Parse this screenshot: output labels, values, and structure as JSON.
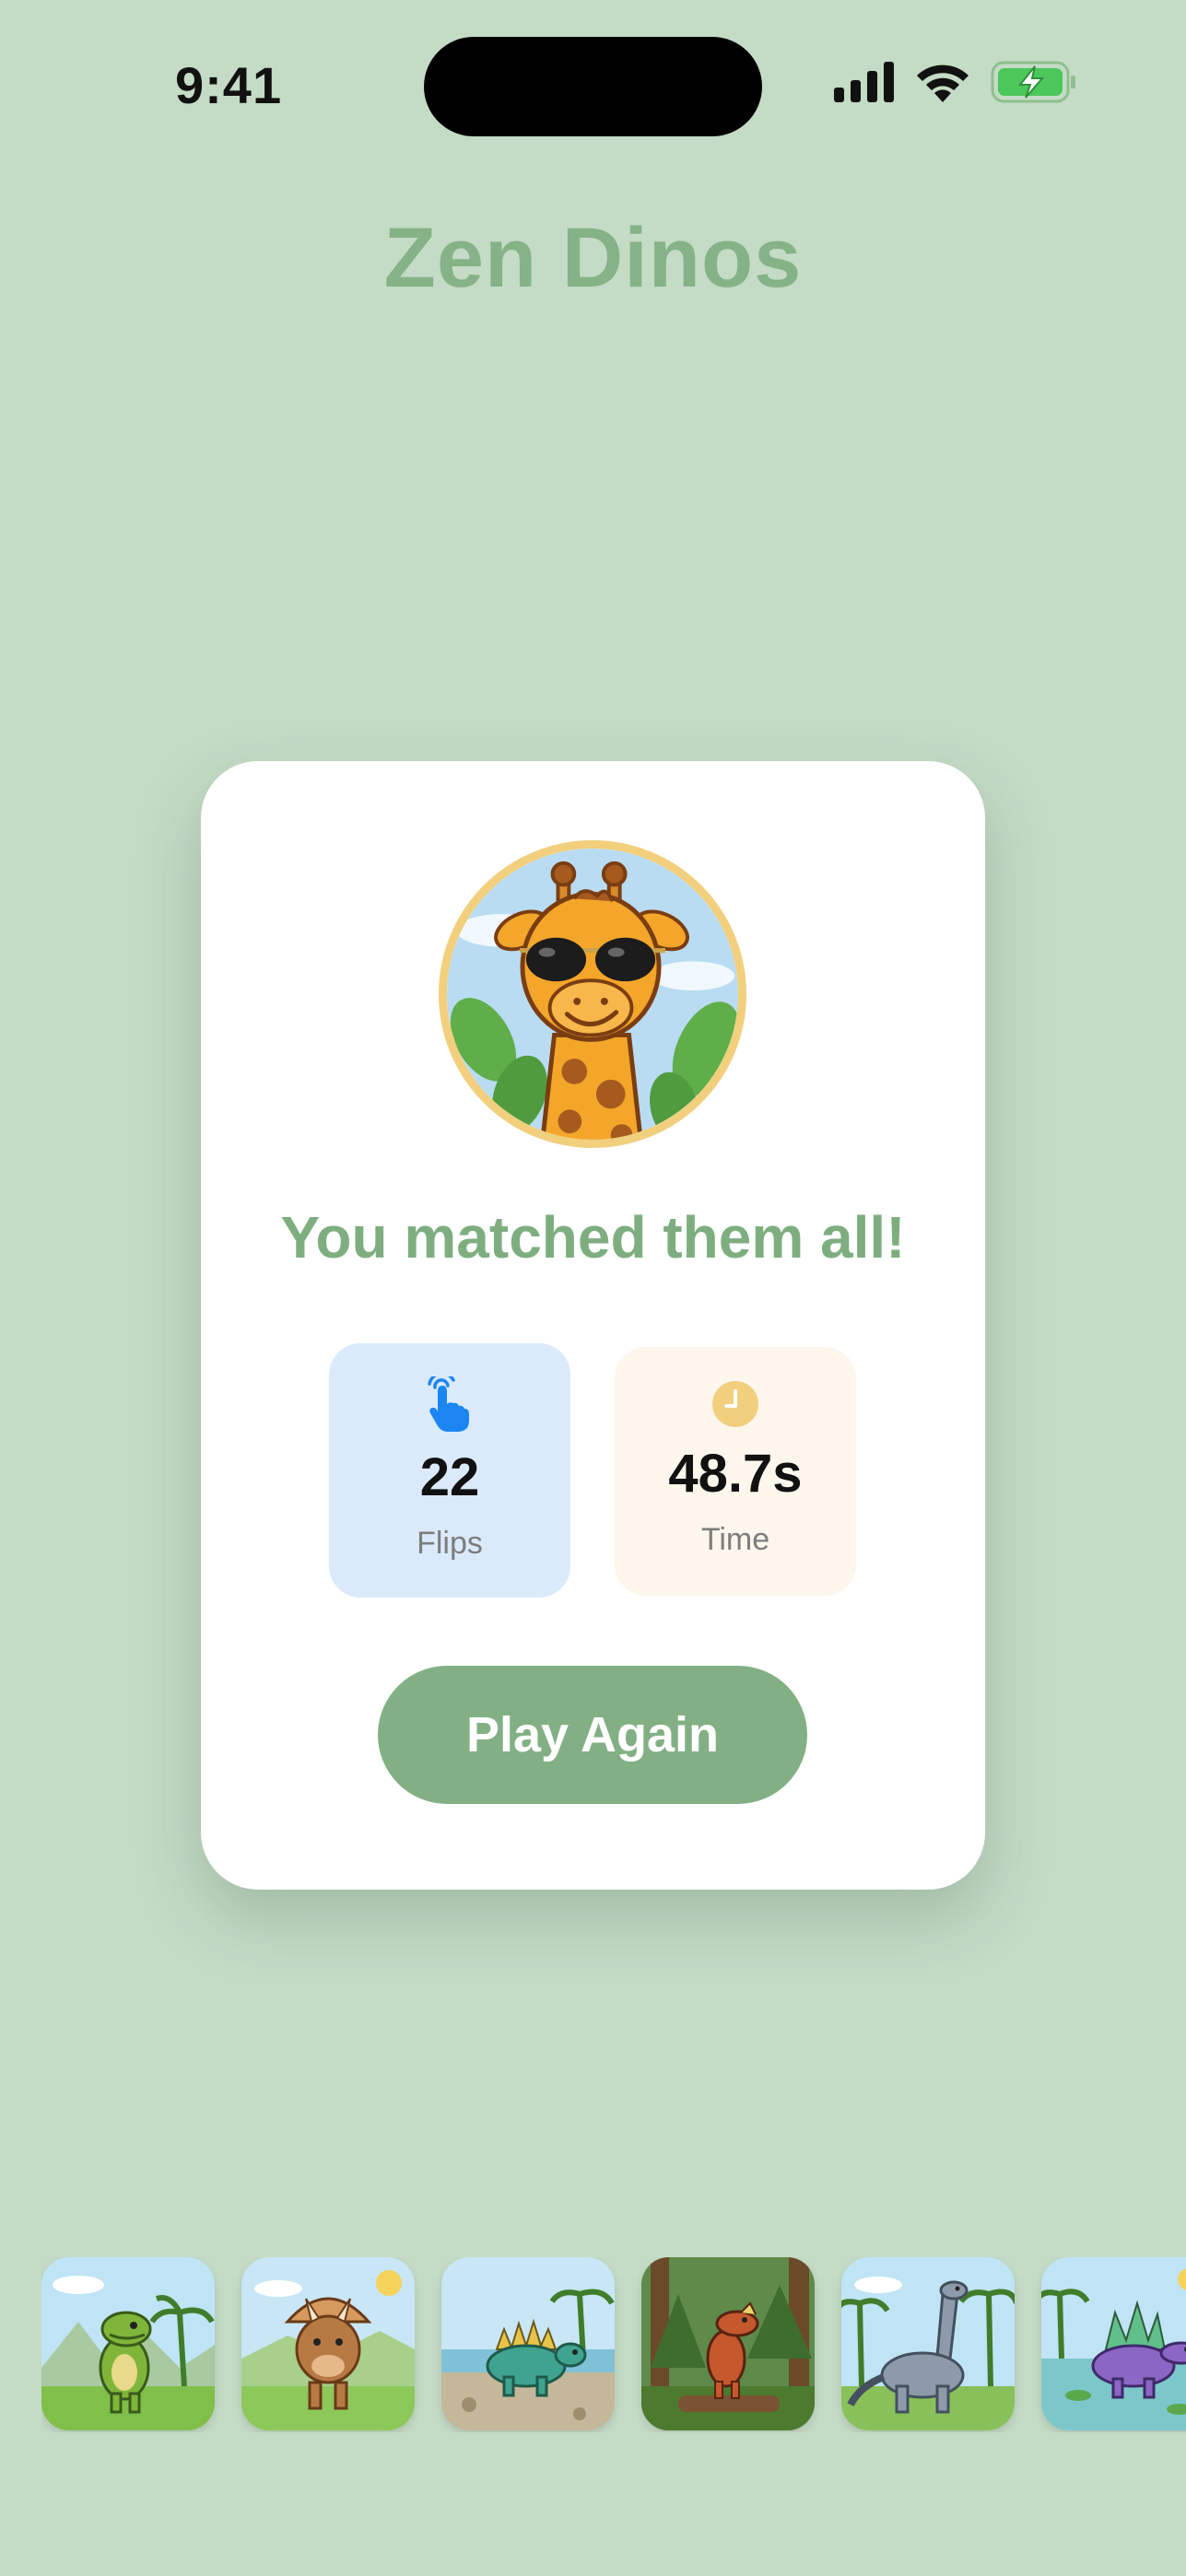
{
  "status_bar": {
    "time": "9:41",
    "icons": [
      "cellular-signal-icon",
      "wifi-icon",
      "battery-charging-icon"
    ]
  },
  "app": {
    "title": "Zen Dinos"
  },
  "result": {
    "avatar_icon": "giraffe-with-sunglasses-avatar",
    "message": "You matched them all!",
    "stats": {
      "flips": {
        "icon": "tap-hand-icon",
        "value": "22",
        "label": "Flips"
      },
      "time": {
        "icon": "clock-icon",
        "value": "48.7s",
        "label": "Time"
      }
    },
    "play_again_label": "Play Again"
  },
  "dinos": [
    {
      "name": "t-rex-card",
      "accent": "#7fb63a"
    },
    {
      "name": "triceratops-card",
      "accent": "#b87a44"
    },
    {
      "name": "stegosaurus-card",
      "accent": "#3fa38f"
    },
    {
      "name": "velociraptor-card",
      "accent": "#c5582d"
    },
    {
      "name": "brachiosaurus-card",
      "accent": "#8c9aaa"
    },
    {
      "name": "spinosaurus-card",
      "accent": "#8c66c4"
    }
  ],
  "colors": {
    "background": "#c4dbc6",
    "accent_green": "#82b084",
    "flips_tile": "#dbeafb",
    "time_tile": "#fdf6ec",
    "avatar_border": "#f1cf7d"
  }
}
